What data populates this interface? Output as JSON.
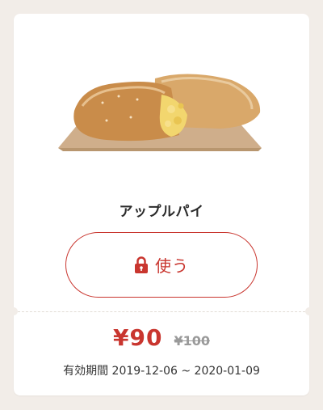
{
  "coupon": {
    "product_name": "アップルパイ",
    "use_button_label": "使う",
    "price": "¥90",
    "original_price": "¥100",
    "validity_label": "有効期間",
    "validity_range": "2019-12-06 ~ 2020-01-09"
  },
  "icons": {
    "lock": "lock-icon"
  },
  "colors": {
    "accent": "#c9362f",
    "background": "#f2ede8",
    "card": "#ffffff",
    "muted": "#9a9a9a"
  }
}
